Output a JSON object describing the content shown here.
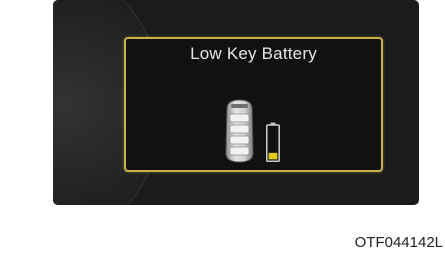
{
  "display": {
    "message": "Low Key Battery",
    "icons": [
      "smart-key-icon",
      "low-battery-icon"
    ],
    "battery_level": 0.2,
    "colors": {
      "panel_border": "#c9b24a",
      "battery_low": "#e3cc20",
      "screen_bg": "#1b1b1b"
    }
  },
  "caption": "OTF044142L"
}
